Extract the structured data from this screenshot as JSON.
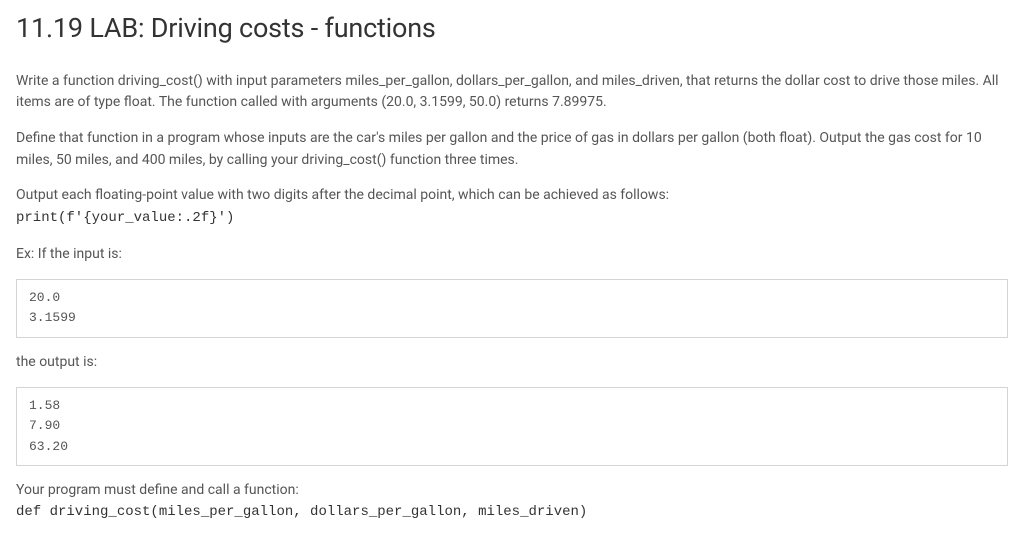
{
  "title": "11.19 LAB: Driving costs - functions",
  "para1": "Write a function driving_cost() with input parameters miles_per_gallon, dollars_per_gallon, and miles_driven, that returns the dollar cost to drive those miles. All items are of type float. The function called with arguments (20.0, 3.1599, 50.0) returns 7.89975.",
  "para2": "Define that function in a program whose inputs are the car's miles per gallon and the price of gas in dollars per gallon (both float). Output the gas cost for 10 miles, 50 miles, and 400 miles, by calling your driving_cost() function three times.",
  "para3_lead": "Output each floating-point value with two digits after the decimal point, which can be achieved as follows:",
  "print_stmt": "print(f'{your_value:.2f}')",
  "ex_input_label": "Ex: If the input is:",
  "input_block": "20.0\n3.1599",
  "output_label": "the output is:",
  "output_block": "1.58\n7.90\n63.20",
  "must_define": "Your program must define and call a function:",
  "def_sig": "def driving_cost(miles_per_gallon, dollars_per_gallon, miles_driven)"
}
